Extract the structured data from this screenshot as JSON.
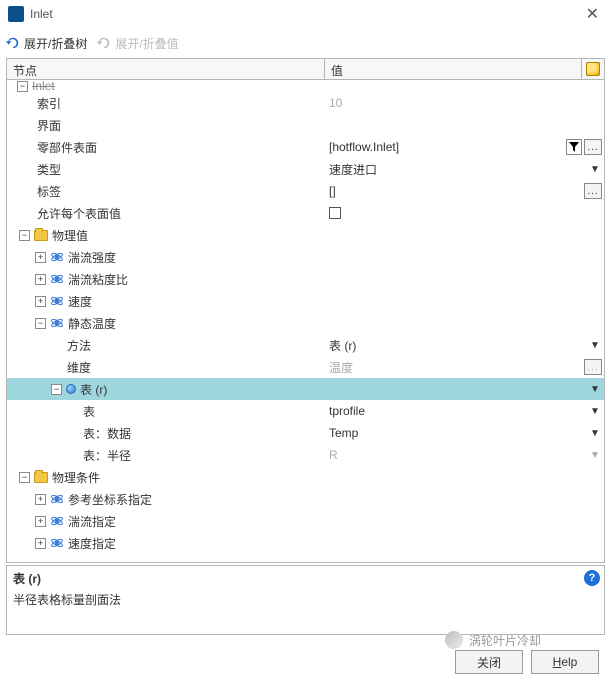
{
  "window": {
    "title": "Inlet"
  },
  "toolbar": {
    "expand_tree": "展开/折叠树",
    "expand_value": "展开/折叠值"
  },
  "grid": {
    "headers": {
      "node": "节点",
      "value": "值"
    }
  },
  "tree": {
    "inlet_label": "Inlet",
    "index": {
      "label": "索引",
      "value": "10"
    },
    "interface": {
      "label": "界面",
      "value": ""
    },
    "part_surface": {
      "label": "零部件表面",
      "value": "[hotflow.Inlet]"
    },
    "type": {
      "label": "类型",
      "value": "速度进口"
    },
    "tag": {
      "label": "标签",
      "value": "[]"
    },
    "allow_per_surface": {
      "label": "允许每个表面值",
      "checked": false
    },
    "phys_values": {
      "label": "物理值",
      "turb_intensity": "湍流强度",
      "turb_visc_ratio": "湍流粘度比",
      "velocity": "速度",
      "static_temp": {
        "label": "静态温度",
        "method": {
          "label": "方法",
          "value": "表 (r)"
        },
        "dimension": {
          "label": "维度",
          "value": "温度"
        },
        "table_r": {
          "label": "表 (r)",
          "table": {
            "label": "表",
            "value": "tprofile"
          },
          "table_data": {
            "label": "表：数据",
            "value": "Temp"
          },
          "table_radius": {
            "label": "表：半径",
            "value": "R"
          }
        }
      }
    },
    "phys_conditions": {
      "label": "物理条件",
      "ref_frame": "参考坐标系指定",
      "turb_spec": "湍流指定",
      "vel_spec": "速度指定"
    }
  },
  "description": {
    "title": "表 (r)",
    "body": "半径表格标量剖面法"
  },
  "footer": {
    "close": "关闭",
    "help": "Help"
  },
  "watermark": "涡轮叶片冷却"
}
